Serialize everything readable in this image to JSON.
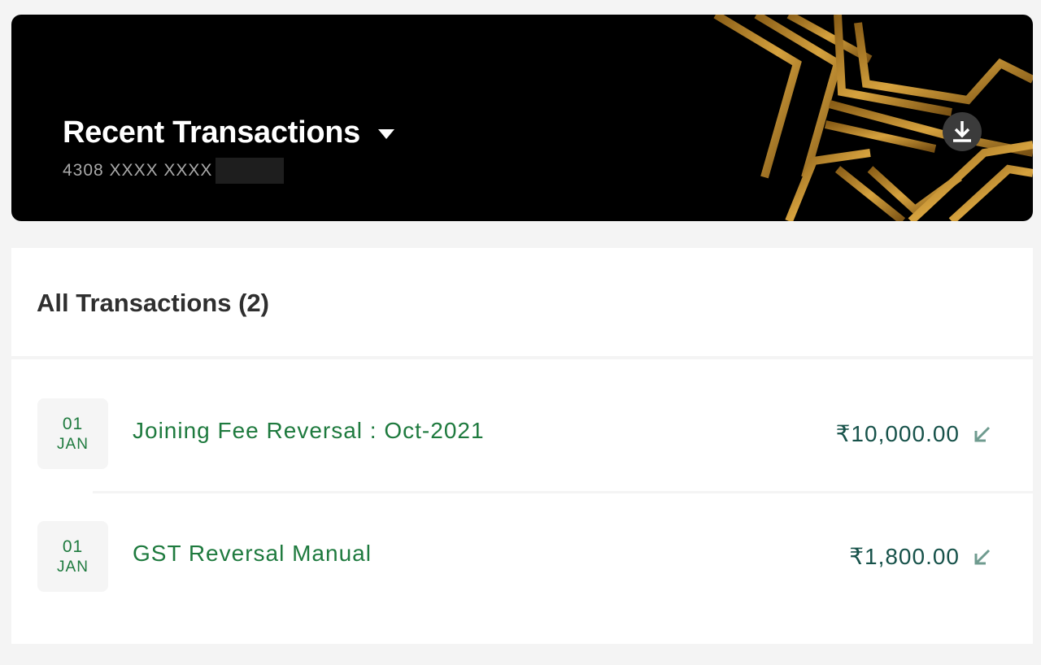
{
  "header": {
    "title": "Recent Transactions",
    "card_number": "4308 XXXX XXXX",
    "download_icon": "download-icon",
    "dropdown_icon": "caret-down-icon"
  },
  "transactions": {
    "heading": "All Transactions (2)",
    "items": [
      {
        "day": "01",
        "month": "JAN",
        "description": "Joining Fee Reversal : Oct-2021",
        "amount": "₹10,000.00",
        "direction_icon": "arrow-down-left-icon"
      },
      {
        "day": "01",
        "month": "JAN",
        "description": "GST Reversal Manual",
        "amount": "₹1,800.00",
        "direction_icon": "arrow-down-left-icon"
      }
    ]
  },
  "colors": {
    "accent_green": "#1e7a3e",
    "amount_teal": "#17524a",
    "gold": "#c08a2a"
  }
}
